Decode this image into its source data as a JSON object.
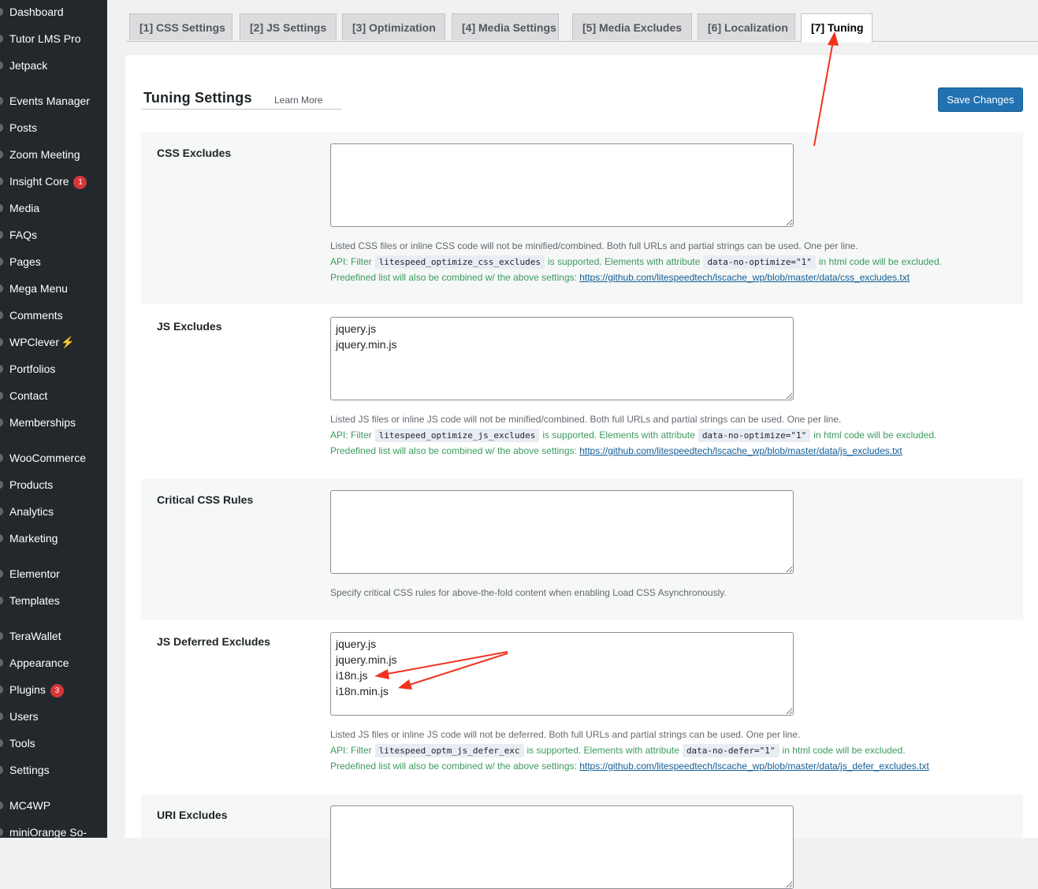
{
  "sidebar": {
    "items": [
      {
        "label": "Dashboard"
      },
      {
        "label": "Tutor LMS Pro"
      },
      {
        "label": "Jetpack"
      },
      {
        "label": "Events Manager"
      },
      {
        "label": "Posts"
      },
      {
        "label": "Zoom Meeting"
      },
      {
        "label": "Insight Core",
        "badge": "1"
      },
      {
        "label": "Media"
      },
      {
        "label": "FAQs"
      },
      {
        "label": "Pages"
      },
      {
        "label": "Mega Menu"
      },
      {
        "label": "Comments"
      },
      {
        "label": "WPClever",
        "icon": "lightning-icon"
      },
      {
        "label": "Portfolios"
      },
      {
        "label": "Contact"
      },
      {
        "label": "Memberships"
      },
      {
        "label": "WooCommerce"
      },
      {
        "label": "Products"
      },
      {
        "label": "Analytics"
      },
      {
        "label": "Marketing"
      },
      {
        "label": "Elementor"
      },
      {
        "label": "Templates"
      },
      {
        "label": "TeraWallet"
      },
      {
        "label": "Appearance"
      },
      {
        "label": "Plugins",
        "badge": "3"
      },
      {
        "label": "Users"
      },
      {
        "label": "Tools"
      },
      {
        "label": "Settings"
      },
      {
        "label": "MC4WP"
      },
      {
        "label": "miniOrange So-"
      }
    ]
  },
  "tabs": [
    {
      "label": "[1] CSS Settings"
    },
    {
      "label": "[2] JS Settings"
    },
    {
      "label": "[3] Optimization"
    },
    {
      "label": "[4] Media Settings"
    },
    {
      "label": "[5] Media Excludes"
    },
    {
      "label": "[6] Localization"
    },
    {
      "label": "[7] Tuning",
      "active": true
    }
  ],
  "page": {
    "title": "Tuning Settings",
    "learn_more": "Learn More",
    "save_label": "Save Changes"
  },
  "sections": {
    "css_excludes": {
      "label": "CSS Excludes",
      "value": "",
      "desc1": "Listed CSS files or inline CSS code will not be minified/combined. Both full URLs and partial strings can be used. One per line.",
      "api_prefix": "API: Filter",
      "api_filter": "litespeed_optimize_css_excludes",
      "api_mid": "is supported. Elements with attribute",
      "api_attr": "data-no-optimize=\"1\"",
      "api_suffix": "in html code will be excluded.",
      "predef_prefix": "Predefined list will also be combined w/ the above settings:",
      "predef_link": "https://github.com/litespeedtech/lscache_wp/blob/master/data/css_excludes.txt"
    },
    "js_excludes": {
      "label": "JS Excludes",
      "value": "jquery.js\njquery.min.js",
      "desc1": "Listed JS files or inline JS code will not be minified/combined. Both full URLs and partial strings can be used. One per line.",
      "api_prefix": "API: Filter",
      "api_filter": "litespeed_optimize_js_excludes",
      "api_mid": "is supported. Elements with attribute",
      "api_attr": "data-no-optimize=\"1\"",
      "api_suffix": "in html code will be excluded.",
      "predef_prefix": "Predefined list will also be combined w/ the above settings:",
      "predef_link": "https://github.com/litespeedtech/lscache_wp/blob/master/data/js_excludes.txt"
    },
    "critical_css": {
      "label": "Critical CSS Rules",
      "value": "",
      "desc1": "Specify critical CSS rules for above-the-fold content when enabling Load CSS Asynchronously."
    },
    "js_deferred": {
      "label": "JS Deferred Excludes",
      "value": "jquery.js\njquery.min.js\ni18n.js\ni18n.min.js",
      "desc1": "Listed JS files or inline JS code will not be deferred. Both full URLs and partial strings can be used. One per line.",
      "api_prefix": "API: Filter",
      "api_filter": "litespeed_optm_js_defer_exc",
      "api_mid": "is supported. Elements with attribute",
      "api_attr": "data-no-defer=\"1\"",
      "api_suffix": "in html code will be excluded.",
      "predef_prefix": "Predefined list will also be combined w/ the above settings:",
      "predef_link": "https://github.com/litespeedtech/lscache_wp/blob/master/data/js_defer_excludes.txt"
    },
    "uri_excludes": {
      "label": "URI Excludes",
      "value": ""
    }
  },
  "colors": {
    "sidebar_bg": "#23282d",
    "accent": "#2271b1",
    "annotation_arrow": "#f0321e",
    "api_text": "#3b9b5e"
  }
}
